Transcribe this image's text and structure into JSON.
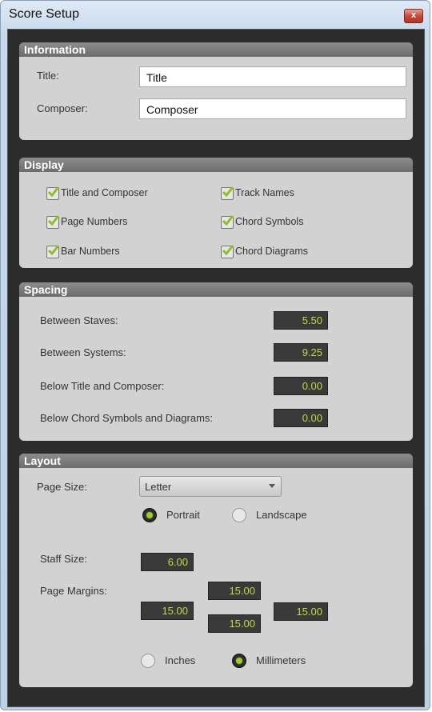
{
  "window": {
    "title": "Score Setup",
    "close_label": "x"
  },
  "information": {
    "header": "Information",
    "title_label": "Title:",
    "title_value": "Title",
    "composer_label": "Composer:",
    "composer_value": "Composer"
  },
  "display": {
    "header": "Display",
    "checkboxes": [
      {
        "label": "Title and Composer",
        "checked": true
      },
      {
        "label": "Track Names",
        "checked": true
      },
      {
        "label": "Page Numbers",
        "checked": true
      },
      {
        "label": "Chord Symbols",
        "checked": true
      },
      {
        "label": "Bar Numbers",
        "checked": true
      },
      {
        "label": "Chord Diagrams",
        "checked": true
      }
    ]
  },
  "spacing": {
    "header": "Spacing",
    "rows": [
      {
        "label": "Between Staves:",
        "value": "5.50"
      },
      {
        "label": "Between Systems:",
        "value": "9.25"
      },
      {
        "label": "Below Title and Composer:",
        "value": "0.00"
      },
      {
        "label": "Below Chord Symbols and Diagrams:",
        "value": "0.00"
      }
    ]
  },
  "layout": {
    "header": "Layout",
    "page_size_label": "Page Size:",
    "page_size_value": "Letter",
    "orientation": [
      {
        "label": "Portrait",
        "selected": true
      },
      {
        "label": "Landscape",
        "selected": false
      }
    ],
    "staff_size_label": "Staff Size:",
    "staff_size_value": "6.00",
    "page_margins_label": "Page Margins:",
    "margins": {
      "top": "15.00",
      "left": "15.00",
      "right": "15.00",
      "bottom": "15.00"
    },
    "units": [
      {
        "label": "Inches",
        "selected": false
      },
      {
        "label": "Millimeters",
        "selected": true
      }
    ]
  },
  "colors": {
    "accent_green": "#9ccc2c",
    "value_text": "#b8df3d",
    "panel_bg": "#d2d2d2",
    "dialog_bg": "#2c2c2c"
  }
}
